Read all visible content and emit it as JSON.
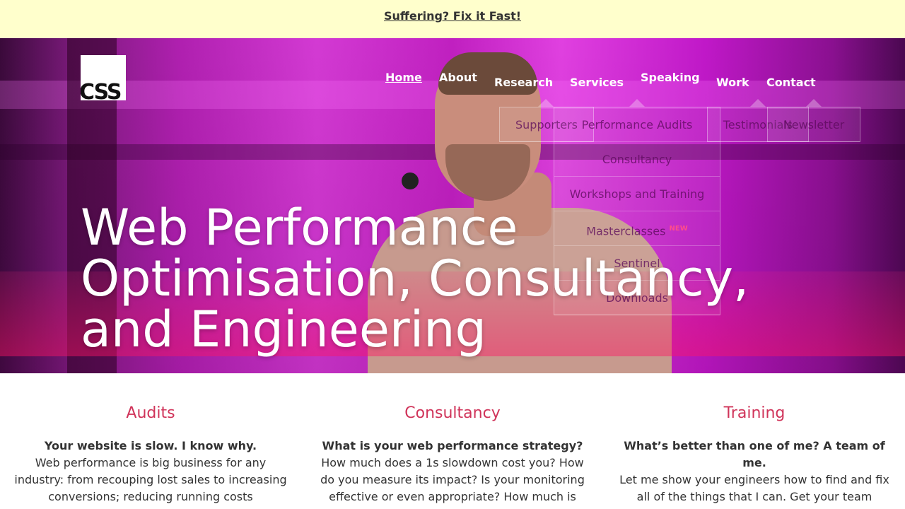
{
  "banner": {
    "text": "Suffering? Fix it Fast!"
  },
  "logo": {
    "text": "CSS"
  },
  "nav": {
    "home": "Home",
    "about": "About",
    "research": "Research",
    "services": "Services",
    "speaking": "Speaking",
    "work": "Work",
    "contact": "Contact"
  },
  "dropdowns": {
    "about": [
      "Supporters"
    ],
    "services": [
      "Performance Audits",
      "Consultancy",
      "Workshops and Training",
      "Masterclasses",
      "Sentinel",
      "Downloads"
    ],
    "services_badge": "NEW",
    "work": [
      "Testimonials"
    ],
    "contact": [
      "Newsletter"
    ]
  },
  "hero": {
    "line1": "Web Performance",
    "line2": "Optimisation, Consultancy,",
    "line3": "and Engineering"
  },
  "columns": [
    {
      "title": "Audits",
      "lead": "Your website is slow. I know why.",
      "body": "Web performance is big business for any industry: from recouping lost sales to increasing conversions; reducing running costs"
    },
    {
      "title": "Consultancy",
      "lead": "What is your web performance strategy?",
      "body": "How much does a 1s slowdown cost you? How do you measure its impact? Is your monitoring effective or even appropriate? How much is"
    },
    {
      "title": "Training",
      "lead": "What’s better than one of me? A team of me.",
      "body": "Let me show your engineers how to find and fix all of the things that I can. Get your team"
    }
  ]
}
